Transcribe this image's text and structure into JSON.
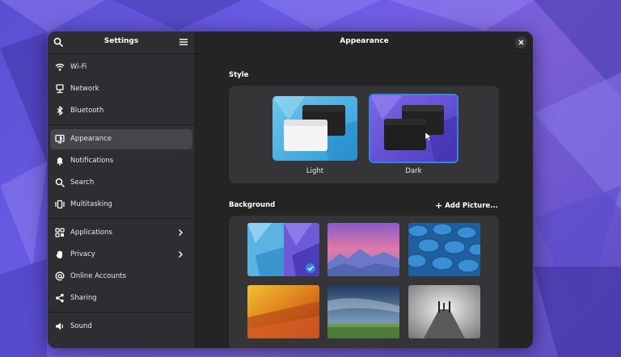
{
  "sidebar": {
    "title": "Settings",
    "items": [
      {
        "label": "Wi-Fi",
        "icon": "wifi-icon"
      },
      {
        "label": "Network",
        "icon": "network-icon"
      },
      {
        "label": "Bluetooth",
        "icon": "bluetooth-icon"
      },
      {
        "label": "Appearance",
        "icon": "appearance-icon",
        "active": true
      },
      {
        "label": "Notifications",
        "icon": "bell-icon"
      },
      {
        "label": "Search",
        "icon": "search-icon"
      },
      {
        "label": "Multitasking",
        "icon": "multitasking-icon"
      },
      {
        "label": "Applications",
        "icon": "apps-icon",
        "has_submenu": true
      },
      {
        "label": "Privacy",
        "icon": "hand-icon",
        "has_submenu": true
      },
      {
        "label": "Online Accounts",
        "icon": "at-icon"
      },
      {
        "label": "Sharing",
        "icon": "share-icon"
      },
      {
        "label": "Sound",
        "icon": "speaker-icon"
      }
    ]
  },
  "main": {
    "title": "Appearance",
    "style_section": {
      "label": "Style",
      "options": [
        {
          "label": "Light",
          "selected": false
        },
        {
          "label": "Dark",
          "selected": true
        }
      ]
    },
    "background_section": {
      "label": "Background",
      "add_picture_label": "Add Picture...",
      "selected_index": 0
    }
  },
  "colors": {
    "accent": "#3584e4",
    "window_bg": "#242424",
    "sidebar_bg": "#2e2e32",
    "card_bg": "#353538"
  }
}
